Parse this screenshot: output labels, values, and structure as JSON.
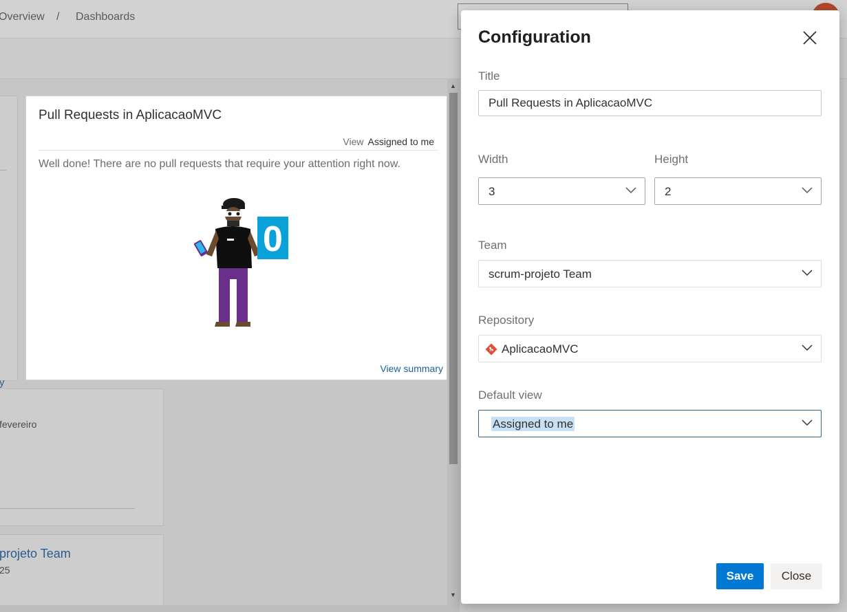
{
  "breadcrumb": {
    "overview": "Overview",
    "separator": "/",
    "dashboards": "Dashboards"
  },
  "pr_tile": {
    "title": "Pull Requests in AplicacaoMVC",
    "view_label": "View",
    "view_value": "Assigned to me",
    "message": "Well done! There are no pull requests that require your attention right now.",
    "count": "0",
    "summary_link": "View summary"
  },
  "background": {
    "left_tile_link": "y",
    "date_fragment": "fevereiro",
    "team_link": "projeto Team",
    "number_fragment": "25"
  },
  "config": {
    "title": "Configuration",
    "title_label": "Title",
    "title_value": "Pull Requests in AplicacaoMVC",
    "width_label": "Width",
    "width_value": "3",
    "height_label": "Height",
    "height_value": "2",
    "team_label": "Team",
    "team_value": "scrum-projeto Team",
    "repository_label": "Repository",
    "repository_value": "AplicacaoMVC",
    "default_view_label": "Default view",
    "default_view_value": "Assigned to me",
    "save_label": "Save",
    "close_label": "Close"
  },
  "icons": {
    "close": "close-icon",
    "chevron": "chevron-down-icon",
    "repo": "git-repo-icon"
  },
  "colors": {
    "accent": "#0078d4",
    "git_icon": "#e8492f",
    "count_tile": "#0aa0d8",
    "link": "#1f5f9a"
  }
}
